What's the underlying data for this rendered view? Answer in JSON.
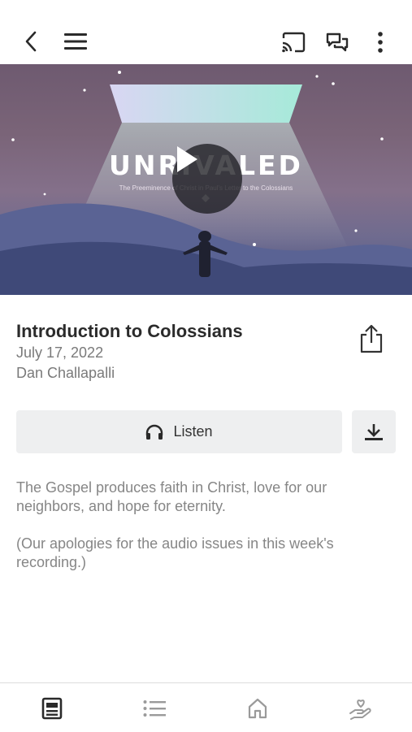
{
  "hero": {
    "title": "UNRIVALED",
    "subtitle": "The Preeminence of Christ in Paul's Letter to the Colossians"
  },
  "sermon": {
    "title": "Introduction to Colossians",
    "date": "July 17, 2022",
    "speaker": "Dan Challapalli"
  },
  "actions": {
    "listen_label": "Listen"
  },
  "description": {
    "para1": "The Gospel produces faith in Christ, love for our neighbors, and hope for eternity.",
    "para2": "(Our apologies for the audio issues in this week's recording.)"
  },
  "icons": {
    "back": "back-chevron-icon",
    "menu": "hamburger-menu-icon",
    "cast": "cast-icon",
    "chat": "chat-icon",
    "more": "more-vertical-icon",
    "play": "play-icon",
    "share": "share-icon",
    "headphones": "headphones-icon",
    "download": "download-icon",
    "tab_media": "media-tab-icon",
    "tab_list": "list-tab-icon",
    "tab_home": "home-tab-icon",
    "tab_give": "give-tab-icon"
  },
  "colors": {
    "icon_dark": "#2a2a2a",
    "icon_inactive": "#9a9a9a",
    "button_bg": "#eeeff0",
    "muted_text": "#868686"
  }
}
